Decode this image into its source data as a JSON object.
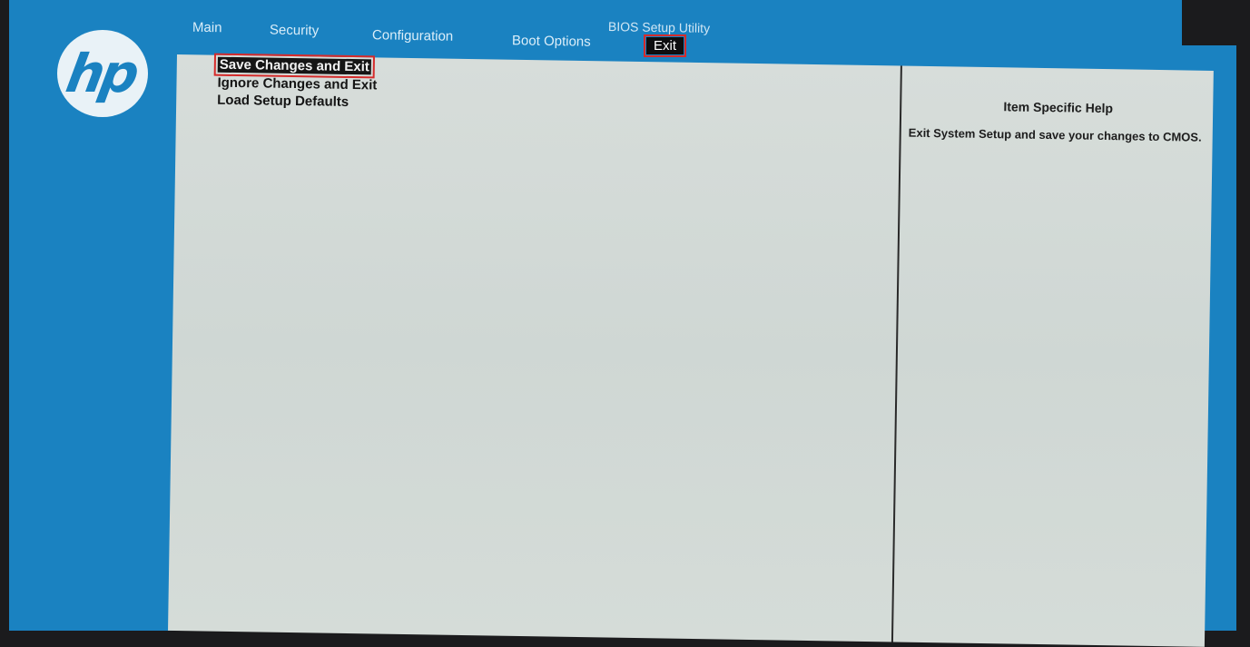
{
  "app_title": "BIOS Setup Utility",
  "brand": {
    "logo_text": "hp",
    "color": "#1a82c1"
  },
  "tabs": [
    {
      "label": "Main",
      "active": false
    },
    {
      "label": "Security",
      "active": false
    },
    {
      "label": "Configuration",
      "active": false
    },
    {
      "label": "Boot Options",
      "active": false
    },
    {
      "label": "Exit",
      "active": true
    }
  ],
  "menu": {
    "items": [
      {
        "label": "Save Changes and Exit",
        "selected": true
      },
      {
        "label": "Ignore Changes and Exit",
        "selected": false
      },
      {
        "label": "Load Setup Defaults",
        "selected": false
      }
    ]
  },
  "help": {
    "title": "Item Specific Help",
    "text": "Exit System Setup and save your changes to CMOS."
  },
  "colors": {
    "frame_blue": "#1a82c1",
    "panel_bg": "#d3dad7",
    "highlight": "#151515",
    "annotation_red": "#d52b2b"
  }
}
